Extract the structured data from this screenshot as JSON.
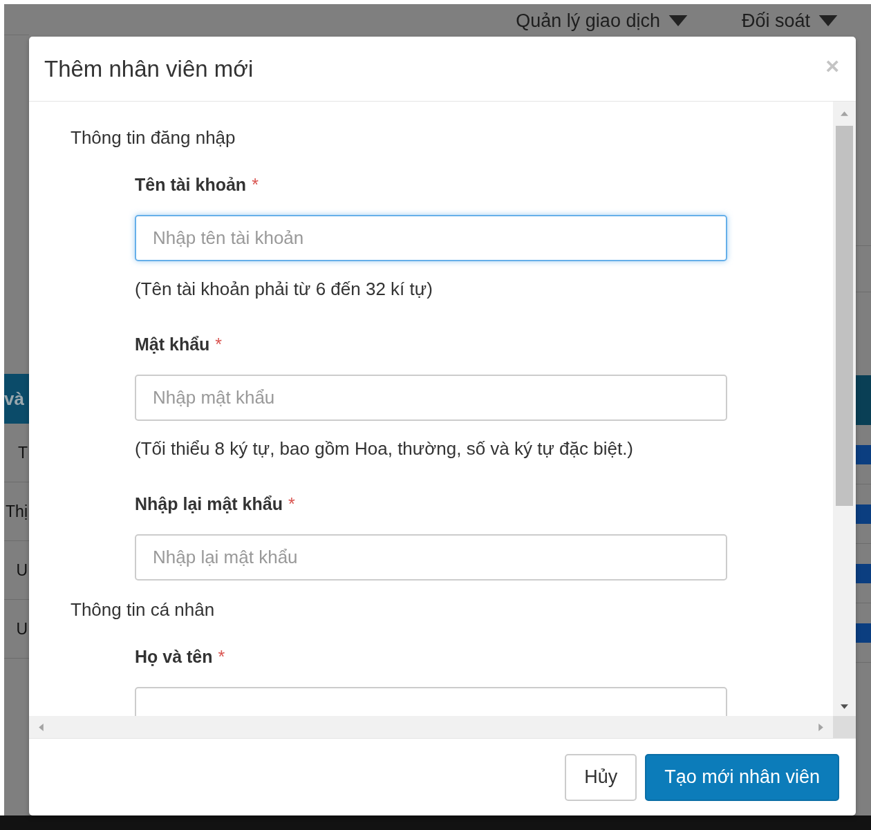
{
  "background": {
    "nav": [
      "Quản lý giao dịch",
      "Đối soát"
    ],
    "table": {
      "header_left": "và",
      "rows": [
        {
          "left": "T"
        },
        {
          "left": "Thị"
        },
        {
          "left": "U"
        },
        {
          "left": "U"
        }
      ]
    }
  },
  "modal": {
    "title": "Thêm nhân viên mới",
    "close": "×",
    "required_mark": "*",
    "sections": [
      {
        "title": "Thông tin đăng nhập",
        "fields": [
          {
            "label": "Tên tài khoản",
            "required": true,
            "placeholder": "Nhập tên tài khoản",
            "focused": true,
            "hint": "(Tên tài khoản phải từ 6 đến 32 kí tự)"
          },
          {
            "label": "Mật khẩu",
            "required": true,
            "placeholder": "Nhập mật khẩu",
            "focused": false,
            "hint": "(Tối thiểu 8 ký tự, bao gồm Hoa, thường, số và ký tự đặc biệt.)"
          },
          {
            "label": "Nhập lại mật khẩu",
            "required": true,
            "placeholder": "Nhập lại mật khẩu",
            "focused": false
          }
        ]
      },
      {
        "title": "Thông tin cá nhân",
        "fields": [
          {
            "label": "Họ và tên",
            "required": true,
            "focused": false
          }
        ]
      }
    ],
    "buttons": [
      {
        "label": "Hủy",
        "kind": "default"
      },
      {
        "label": "Tạo mới nhân viên",
        "kind": "primary"
      }
    ]
  }
}
